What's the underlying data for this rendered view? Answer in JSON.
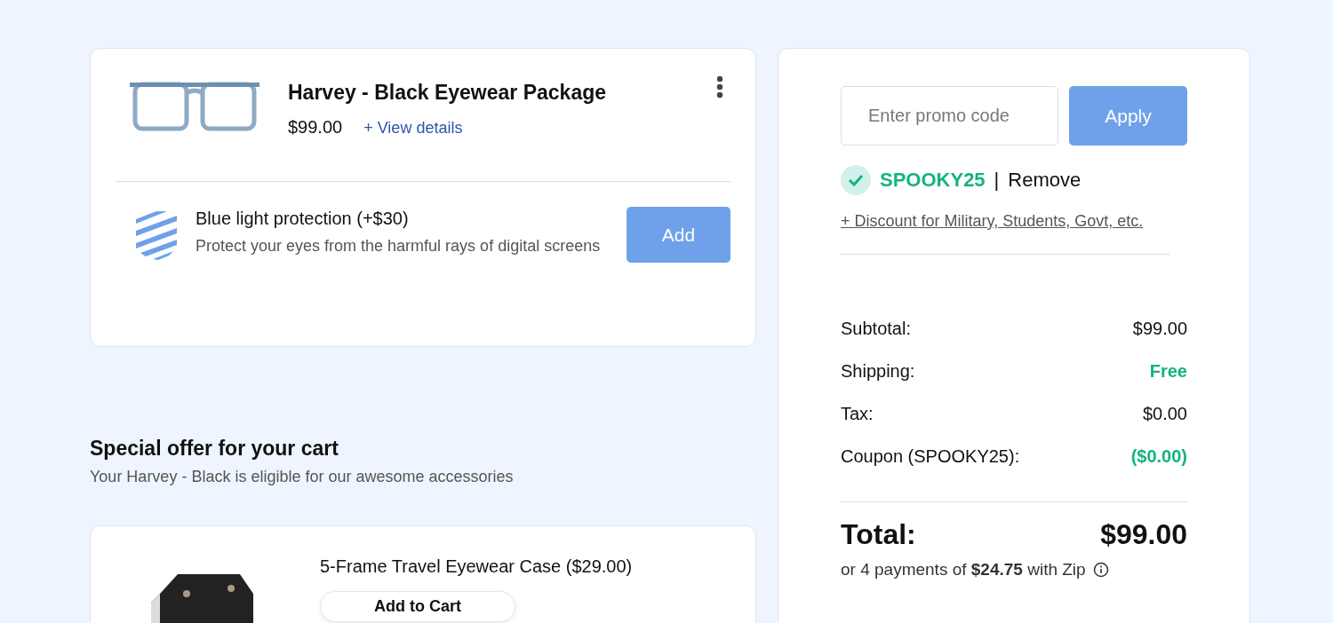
{
  "product": {
    "title": "Harvey - Black Eyewear Package",
    "price": "$99.00",
    "details_link": "+ View details"
  },
  "addon": {
    "title": "Blue light protection (+$30)",
    "description": "Protect your eyes from the harmful rays of digital screens",
    "button": "Add"
  },
  "offer": {
    "heading": "Special offer for your cart",
    "subtitle": "Your Harvey - Black is eligible for our awesome accessories"
  },
  "accessory": {
    "title": "5-Frame Travel Eyewear Case ($29.00)",
    "button": "Add to Cart"
  },
  "promo": {
    "placeholder": "Enter promo code",
    "button": "Apply"
  },
  "coupon": {
    "code": "SPOOKY25",
    "separator": "|",
    "remove": "Remove"
  },
  "discount_link": "+ Discount for Military, Students, Govt, etc.",
  "summary": [
    {
      "label": "Subtotal:",
      "value": "$99.00",
      "kind": "plain"
    },
    {
      "label": "Shipping:",
      "value": "Free",
      "kind": "savings"
    },
    {
      "label": "Tax:",
      "value": "$0.00",
      "kind": "plain"
    },
    {
      "label": "Coupon (SPOOKY25):",
      "value": "($0.00)",
      "kind": "savings"
    }
  ],
  "total": {
    "label": "Total:",
    "value": "$99.00"
  },
  "installments": "or 4 payments of **$24.75** with  Zip"
}
